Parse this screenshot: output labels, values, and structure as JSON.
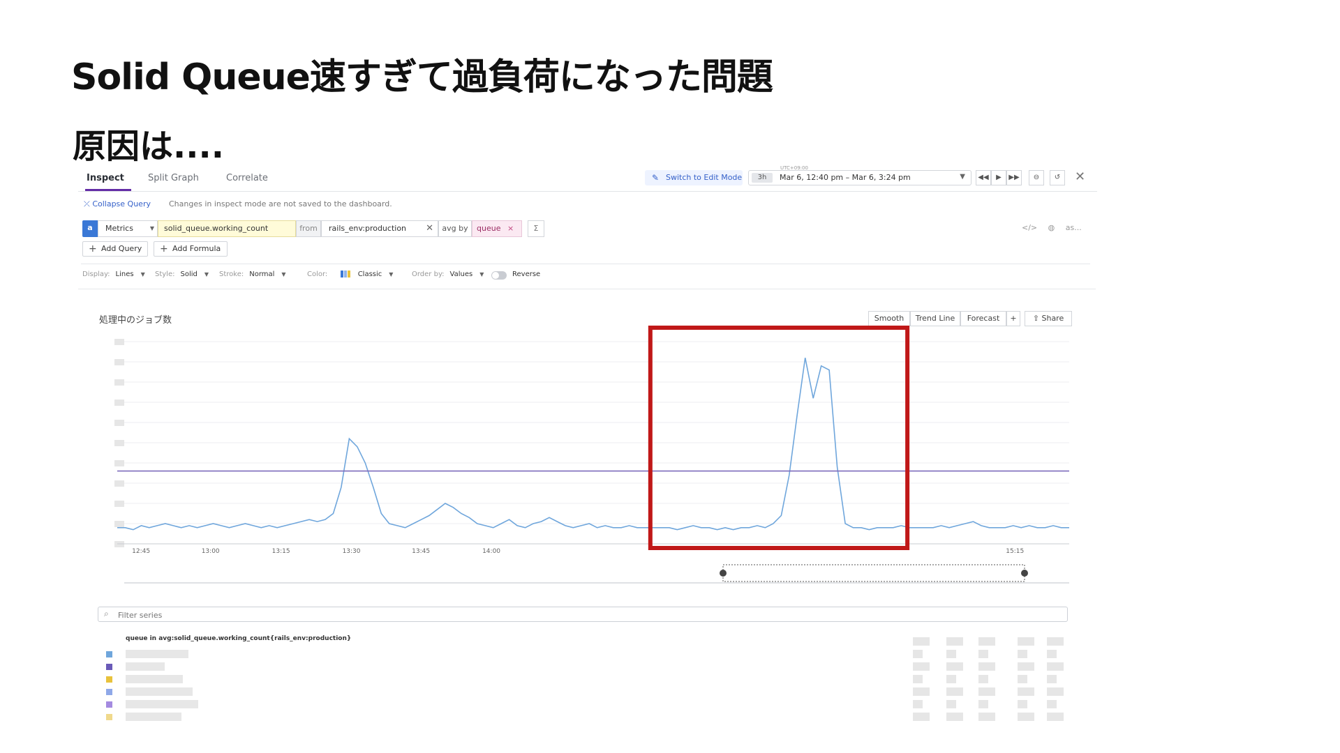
{
  "slide": {
    "title": "Solid Queue速すぎて過負荷になった問題",
    "subtitle": "原因は...."
  },
  "tabs": [
    {
      "label": "Inspect",
      "active": true
    },
    {
      "label": "Split Graph",
      "active": false
    },
    {
      "label": "Correlate",
      "active": false
    }
  ],
  "toolbar": {
    "edit_mode_label": "Switch to Edit Mode",
    "timezone": "UTC+09:00",
    "range_pill": "3h",
    "time_range": "Mar 6, 12:40 pm – Mar 6, 3:24 pm"
  },
  "query_panel": {
    "collapse_label": "Collapse Query",
    "notice": "Changes in inspect mode are not saved to the dashboard.",
    "query_letter": "a",
    "source": "Metrics",
    "metric": "solid_queue.working_count",
    "from_label": "from",
    "tag": "rails_env:production",
    "avg_by_label": "avg by",
    "group": "queue",
    "sigma": "Σ",
    "right_label": "as...",
    "add_query_label": "Add Query",
    "add_formula_label": "Add Formula"
  },
  "display_options": {
    "display_label": "Display:",
    "display_value": "Lines",
    "style_label": "Style:",
    "style_value": "Solid",
    "stroke_label": "Stroke:",
    "stroke_value": "Normal",
    "color_label": "Color:",
    "color_value": "Classic",
    "order_label": "Order by:",
    "order_value": "Values",
    "reverse_label": "Reverse"
  },
  "graph": {
    "title": "処理中のジョブ数",
    "buttons": {
      "smooth": "Smooth",
      "trend": "Trend Line",
      "forecast": "Forecast",
      "plus": "+",
      "share": "Share"
    }
  },
  "filter": {
    "placeholder": "Filter series"
  },
  "legend": {
    "header": "queue in avg:solid_queue.working_count{rails_env:production}",
    "colors": [
      "#6fa6dc",
      "#6a5ab8",
      "#e8c23c",
      "#8fa8e8",
      "#a48be0",
      "#f0d98c"
    ]
  },
  "chart_data": {
    "type": "line",
    "x_ticks": [
      "12:45",
      "13:00",
      "13:15",
      "13:30",
      "13:45",
      "14:00",
      "15:15"
    ],
    "colors": {
      "spiky": "#6fa6dc",
      "flat": "#7e6bbb",
      "highlight": "#c01818"
    },
    "series": [
      {
        "values": [
          0.08,
          0.08,
          0.07,
          0.09,
          0.08,
          0.09,
          0.1,
          0.09,
          0.08,
          0.09,
          0.08,
          0.09,
          0.1,
          0.09,
          0.08,
          0.09,
          0.1,
          0.09,
          0.08,
          0.09,
          0.08,
          0.09,
          0.1,
          0.11,
          0.12,
          0.11,
          0.12,
          0.15,
          0.28,
          0.52,
          0.48,
          0.4,
          0.28,
          0.15,
          0.1,
          0.09,
          0.08,
          0.1,
          0.12,
          0.14,
          0.17,
          0.2,
          0.18,
          0.15,
          0.13,
          0.1,
          0.09,
          0.08,
          0.1,
          0.12,
          0.09,
          0.08,
          0.1,
          0.11,
          0.13,
          0.11,
          0.09,
          0.08,
          0.09,
          0.1,
          0.08,
          0.09,
          0.08,
          0.08,
          0.09,
          0.08,
          0.08,
          0.08,
          0.08,
          0.08,
          0.07,
          0.08,
          0.09,
          0.08,
          0.08,
          0.07,
          0.08,
          0.07,
          0.08,
          0.08,
          0.09,
          0.08,
          0.1,
          0.14,
          0.34,
          0.64,
          0.92,
          0.72,
          0.88,
          0.86,
          0.38,
          0.1,
          0.08,
          0.08,
          0.07,
          0.08,
          0.08,
          0.08,
          0.09,
          0.08,
          0.08,
          0.08,
          0.08,
          0.09,
          0.08,
          0.09,
          0.1,
          0.11,
          0.09,
          0.08,
          0.08,
          0.08,
          0.09,
          0.08,
          0.09,
          0.08,
          0.08,
          0.09,
          0.08,
          0.08
        ]
      },
      {
        "values": [
          0.36,
          0.36,
          0.36,
          0.36,
          0.36,
          0.36,
          0.36,
          0.36,
          0.36,
          0.36,
          0.36,
          0.36,
          0.36,
          0.36,
          0.36,
          0.36,
          0.36,
          0.36,
          0.36,
          0.36,
          0.36,
          0.36,
          0.36,
          0.36,
          0.36,
          0.36,
          0.36,
          0.36,
          0.36,
          0.36,
          0.36,
          0.36,
          0.36,
          0.36,
          0.36,
          0.36,
          0.36,
          0.36,
          0.36,
          0.36,
          0.36,
          0.36,
          0.36,
          0.36,
          0.36,
          0.36,
          0.36,
          0.36,
          0.36,
          0.36,
          0.36,
          0.36,
          0.36,
          0.36,
          0.36,
          0.36,
          0.36,
          0.36,
          0.36,
          0.36,
          0.36,
          0.36,
          0.36,
          0.36,
          0.36,
          0.36,
          0.36,
          0.36,
          0.36,
          0.36,
          0.36,
          0.36,
          0.36,
          0.36,
          0.36,
          0.36,
          0.36,
          0.36,
          0.36,
          0.36,
          0.36,
          0.36,
          0.36,
          0.36,
          0.36,
          0.36,
          0.36,
          0.36,
          0.36,
          0.36,
          0.36,
          0.36,
          0.36,
          0.36,
          0.36,
          0.36,
          0.36,
          0.36,
          0.36,
          0.36,
          0.36,
          0.36,
          0.36,
          0.36,
          0.36,
          0.36,
          0.36,
          0.36,
          0.36,
          0.36,
          0.36,
          0.36,
          0.36,
          0.36,
          0.36,
          0.36,
          0.36,
          0.36,
          0.36,
          0.36
        ]
      }
    ],
    "ylim": [
      0,
      1
    ],
    "grid": true,
    "highlight_range_fraction": [
      0.56,
      0.83
    ]
  }
}
